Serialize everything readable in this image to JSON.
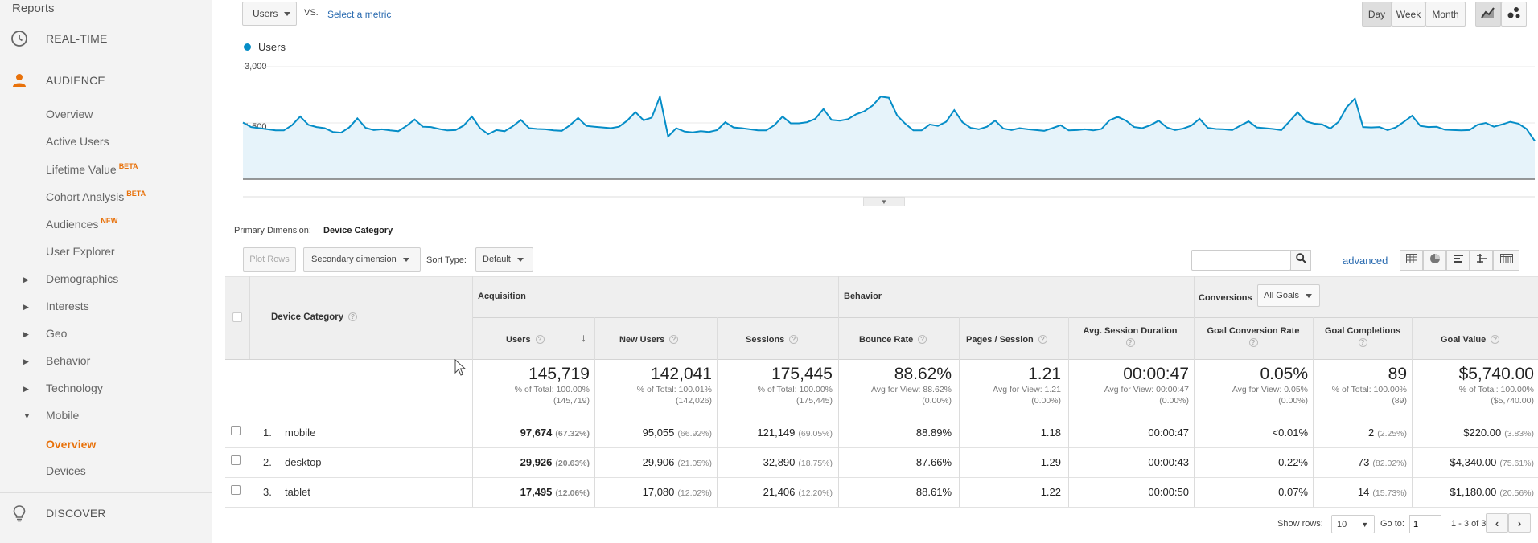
{
  "sidebar": {
    "reports_label": "Reports",
    "realtime_label": "REAL-TIME",
    "audience_label": "AUDIENCE",
    "discover_label": "DISCOVER",
    "audience_items": [
      {
        "label": "Overview"
      },
      {
        "label": "Active Users"
      },
      {
        "label": "Lifetime Value",
        "badge": "BETA"
      },
      {
        "label": "Cohort Analysis",
        "badge": "BETA"
      },
      {
        "label": "Audiences",
        "badge": "NEW"
      },
      {
        "label": "User Explorer"
      },
      {
        "label": "Demographics"
      },
      {
        "label": "Interests"
      },
      {
        "label": "Geo"
      },
      {
        "label": "Behavior"
      },
      {
        "label": "Technology"
      },
      {
        "label": "Mobile"
      },
      {
        "label": "Overview"
      },
      {
        "label": "Devices"
      }
    ],
    "accent_color": "#e8710a"
  },
  "controls": {
    "metric_select": "Users",
    "vs_label": "VS.",
    "select_metric_link": "Select a metric",
    "day_label": "Day",
    "week_label": "Week",
    "month_label": "Month",
    "legend_label": "Users"
  },
  "chart_data": {
    "type": "area",
    "series": [
      {
        "name": "Users",
        "color": "#058dc7",
        "values": [
          1510,
          1390,
          1360,
          1330,
          1300,
          1300,
          1440,
          1670,
          1450,
          1390,
          1360,
          1260,
          1240,
          1380,
          1620,
          1370,
          1310,
          1330,
          1300,
          1280,
          1420,
          1590,
          1400,
          1390,
          1340,
          1300,
          1310,
          1430,
          1670,
          1360,
          1200,
          1310,
          1280,
          1410,
          1580,
          1360,
          1340,
          1330,
          1300,
          1290,
          1440,
          1630,
          1420,
          1400,
          1380,
          1360,
          1400,
          1560,
          1790,
          1570,
          1640,
          2200,
          1140,
          1360,
          1270,
          1250,
          1280,
          1260,
          1310,
          1520,
          1380,
          1360,
          1330,
          1300,
          1300,
          1440,
          1670,
          1490,
          1490,
          1520,
          1610,
          1870,
          1580,
          1560,
          1600,
          1730,
          1810,
          1960,
          2200,
          2170,
          1700,
          1480,
          1300,
          1300,
          1460,
          1420,
          1530,
          1840,
          1520,
          1370,
          1330,
          1400,
          1560,
          1350,
          1310,
          1360,
          1330,
          1310,
          1290,
          1360,
          1440,
          1300,
          1310,
          1330,
          1300,
          1340,
          1570,
          1660,
          1560,
          1390,
          1360,
          1440,
          1560,
          1380,
          1310,
          1350,
          1430,
          1610,
          1370,
          1340,
          1330,
          1310,
          1430,
          1540,
          1380,
          1360,
          1340,
          1310,
          1540,
          1780,
          1540,
          1480,
          1460,
          1350,
          1530,
          1920,
          2150,
          1390,
          1380,
          1390,
          1310,
          1380,
          1530,
          1690,
          1420,
          1390,
          1400,
          1320,
          1310,
          1300,
          1310,
          1450,
          1500,
          1400,
          1460,
          1530,
          1480,
          1340,
          1020
        ]
      }
    ],
    "y_ticks": [
      "3,000",
      "1,500"
    ],
    "ylim": [
      0,
      3000
    ],
    "grid": true
  },
  "table": {
    "primary_dimension_label": "Primary Dimension:",
    "primary_dimension_value": "Device Category",
    "plot_rows": "Plot Rows",
    "secondary_dimension": "Secondary dimension",
    "sort_type_label": "Sort Type:",
    "sort_type_value": "Default",
    "advanced_link": "advanced",
    "search_placeholder": "",
    "group_acquisition": "Acquisition",
    "group_behavior": "Behavior",
    "group_conversions": "Conversions",
    "all_goals": "All Goals",
    "dim_header": "Device Category",
    "headers": [
      "Users",
      "New Users",
      "Sessions",
      "Bounce Rate",
      "Pages / Session",
      "Avg. Session Duration",
      "Goal Conversion Rate",
      "Goal Completions",
      "Goal Value"
    ],
    "totals": [
      {
        "main": "145,719",
        "sub1": "% of Total: 100.00%",
        "sub2": "(145,719)"
      },
      {
        "main": "142,041",
        "sub1": "% of Total: 100.01%",
        "sub2": "(142,026)"
      },
      {
        "main": "175,445",
        "sub1": "% of Total: 100.00%",
        "sub2": "(175,445)"
      },
      {
        "main": "88.62%",
        "sub1": "Avg for View: 88.62%",
        "sub2": "(0.00%)"
      },
      {
        "main": "1.21",
        "sub1": "Avg for View: 1.21",
        "sub2": "(0.00%)"
      },
      {
        "main": "00:00:47",
        "sub1": "Avg for View: 00:00:47",
        "sub2": "(0.00%)"
      },
      {
        "main": "0.05%",
        "sub1": "Avg for View: 0.05%",
        "sub2": "(0.00%)"
      },
      {
        "main": "89",
        "sub1": "% of Total: 100.00%",
        "sub2": "(89)"
      },
      {
        "main": "$5,740.00",
        "sub1": "% of Total: 100.00%",
        "sub2": "($5,740.00)"
      }
    ],
    "rows": [
      {
        "index": "1.",
        "name": "mobile",
        "users": "97,674",
        "users_pct": "(67.32%)",
        "new_users": "95,055",
        "new_users_pct": "(66.92%)",
        "sessions": "121,149",
        "sessions_pct": "(69.05%)",
        "bounce": "88.89%",
        "pages": "1.18",
        "duration": "00:00:47",
        "conv_rate": "<0.01%",
        "completions": "2",
        "completions_pct": "(2.25%)",
        "value": "$220.00",
        "value_pct": "(3.83%)"
      },
      {
        "index": "2.",
        "name": "desktop",
        "users": "29,926",
        "users_pct": "(20.63%)",
        "new_users": "29,906",
        "new_users_pct": "(21.05%)",
        "sessions": "32,890",
        "sessions_pct": "(18.75%)",
        "bounce": "87.66%",
        "pages": "1.29",
        "duration": "00:00:43",
        "conv_rate": "0.22%",
        "completions": "73",
        "completions_pct": "(82.02%)",
        "value": "$4,340.00",
        "value_pct": "(75.61%)"
      },
      {
        "index": "3.",
        "name": "tablet",
        "users": "17,495",
        "users_pct": "(12.06%)",
        "new_users": "17,080",
        "new_users_pct": "(12.02%)",
        "sessions": "21,406",
        "sessions_pct": "(12.20%)",
        "bounce": "88.61%",
        "pages": "1.22",
        "duration": "00:00:50",
        "conv_rate": "0.07%",
        "completions": "14",
        "completions_pct": "(15.73%)",
        "value": "$1,180.00",
        "value_pct": "(20.56%)"
      }
    ],
    "show_rows_label": "Show rows:",
    "show_rows_value": "10",
    "goto_label": "Go to:",
    "goto_value": "1",
    "range_label": "1 - 3 of 3"
  }
}
